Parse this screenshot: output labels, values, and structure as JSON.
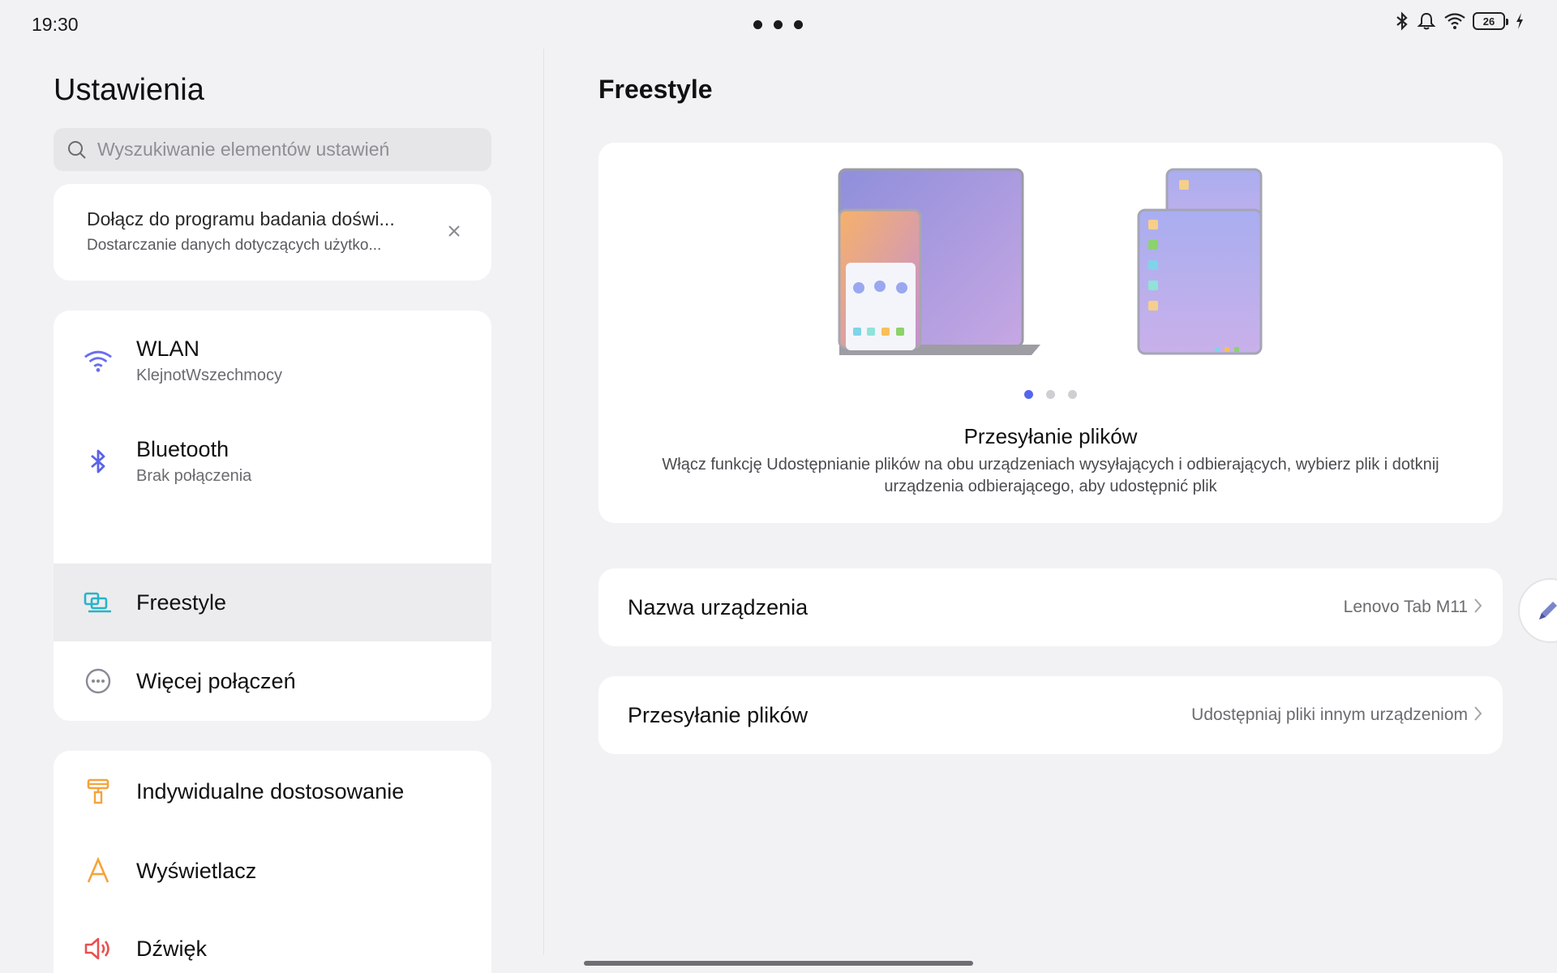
{
  "status_bar": {
    "time": "19:30",
    "battery": "26",
    "icons": [
      "bluetooth-icon",
      "notification-bell-icon",
      "wifi-icon",
      "battery-icon",
      "charging-icon"
    ]
  },
  "sidebar": {
    "title": "Ustawienia",
    "search_placeholder": "Wyszukiwanie elementów ustawień",
    "promo": {
      "title": "Dołącz do programu badania doświ...",
      "subtitle": "Dostarczanie danych dotyczących użytko..."
    },
    "group1": [
      {
        "label": "WLAN",
        "sub": "KlejnotWszechmocy",
        "icon": "wifi-icon"
      },
      {
        "label": "Bluetooth",
        "sub": "Brak połączenia",
        "icon": "bluetooth-icon"
      },
      {
        "label": "Freestyle",
        "icon": "freestyle-icon",
        "selected": true
      },
      {
        "label": "Więcej połączeń",
        "icon": "more-connections-icon"
      }
    ],
    "group2": [
      {
        "label": "Indywidualne dostosowanie",
        "icon": "paint-roller-icon"
      },
      {
        "label": "Wyświetlacz",
        "icon": "display-letter-icon"
      },
      {
        "label": "Dźwięk",
        "icon": "speaker-icon"
      }
    ]
  },
  "main": {
    "title": "Freestyle",
    "hero": {
      "title": "Przesyłanie plików",
      "description": "Włącz funkcję Udostępnianie plików na obu urządzeniach wysyłających i odbierających, wybierz plik i dotknij urządzenia odbierającego, aby udostępnić plik",
      "page_count": 3,
      "active_page": 1
    },
    "rows": [
      {
        "label": "Nazwa urządzenia",
        "value": "Lenovo Tab M11"
      },
      {
        "label": "Przesyłanie plików",
        "value": "Udostępniaj pliki innym urządzeniom"
      }
    ]
  },
  "colors": {
    "accent": "#5566ee",
    "wifi": "#6a6ef0",
    "bluetooth": "#5a63e8",
    "freestyle": "#29b3c8",
    "orange": "#f5a33a",
    "red": "#e8504f",
    "selected_bg": "#ececee"
  }
}
